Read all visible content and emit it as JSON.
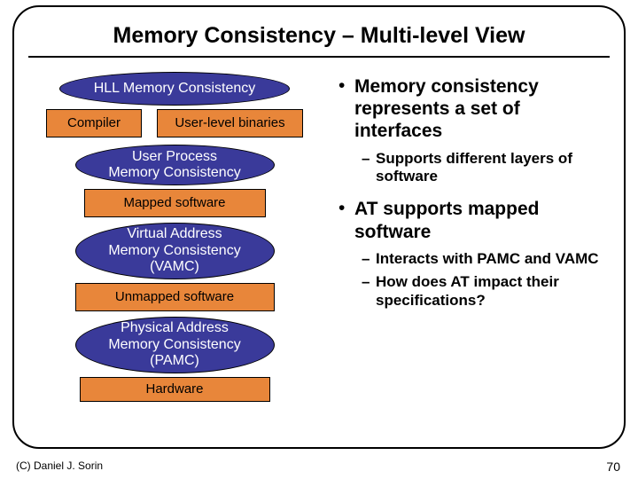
{
  "title": "Memory Consistency – Multi-level View",
  "diagram": {
    "hll": "HLL Memory Consistency",
    "compiler": "Compiler",
    "user_binaries": "User-level binaries",
    "user_process": "User Process\nMemory Consistency",
    "mapped": "Mapped software",
    "vamc": "Virtual Address\nMemory Consistency\n(VAMC)",
    "unmapped": "Unmapped software",
    "pamc": "Physical Address\nMemory Consistency\n(PAMC)",
    "hardware": "Hardware"
  },
  "bullets": {
    "b1": "Memory consistency represents a set of interfaces",
    "s1": "Supports different layers of software",
    "b2": "AT supports mapped software",
    "s2": "Interacts with PAMC and VAMC",
    "s3": "How does AT impact their specifications?"
  },
  "copyright": "(C) Daniel J. Sorin",
  "page_number": "70"
}
